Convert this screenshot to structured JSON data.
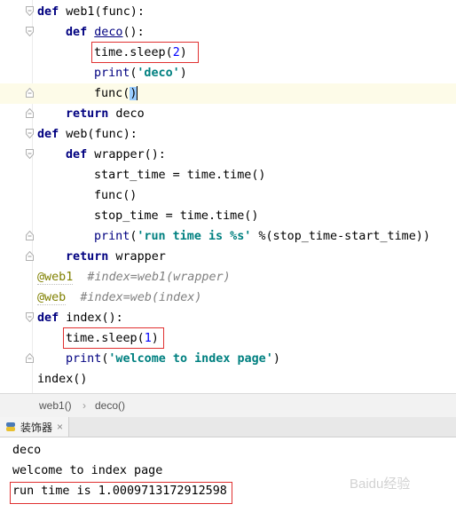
{
  "editor": {
    "lines": {
      "l1": {
        "kw": "def",
        "rest": " web1(func):"
      },
      "l2": {
        "kw": "def",
        "name": "deco",
        "rest": "():"
      },
      "l3": {
        "pre": "time.sleep(",
        "num": "2",
        "post": ")"
      },
      "l4": {
        "fn": "print",
        "open": "(",
        "str": "'deco'",
        "close": ")"
      },
      "l5": {
        "pre": "func(",
        "post": ")"
      },
      "l6": {
        "kw": "return",
        "rest": " deco"
      },
      "l7": {
        "kw": "def",
        "rest": " web(func):"
      },
      "l8": {
        "kw": "def",
        "rest": " wrapper():"
      },
      "l9": {
        "text": "start_time = time.time()"
      },
      "l10": {
        "text": "func()"
      },
      "l11": {
        "text": "stop_time = time.time()"
      },
      "l12": {
        "fn": "print",
        "open": "(",
        "str": "'run time is %s'",
        "rest": " %(stop_time-start_time))"
      },
      "l13": {
        "kw": "return",
        "rest": " wrapper"
      },
      "l14": {
        "dec": "@web1",
        "cmt": "  #index=web1(wrapper)"
      },
      "l15": {
        "dec": "@web",
        "cmt": "  #index=web(index)"
      },
      "l16": {
        "kw": "def",
        "rest": " index():"
      },
      "l17": {
        "pre": "time.sleep(",
        "num": "1",
        "post": ")"
      },
      "l18": {
        "fn": "print",
        "open": "(",
        "str": "'welcome to index page'",
        "close": ")"
      },
      "l19": {
        "text": "index()"
      }
    }
  },
  "breadcrumb": {
    "item1": "web1()",
    "separator": "›",
    "item2": "deco()"
  },
  "run_panel": {
    "tab_label": "装饰器",
    "close_symbol": "×"
  },
  "console": {
    "lines": [
      "deco",
      "welcome to index page",
      "run time is 1.0009713172912598"
    ]
  },
  "watermark": "Baidu经验",
  "colors": {
    "keyword": "#000080",
    "string": "#008080",
    "number": "#0000ff",
    "decorator": "#808000",
    "comment": "#808080",
    "highlight_box": "#e03030"
  }
}
